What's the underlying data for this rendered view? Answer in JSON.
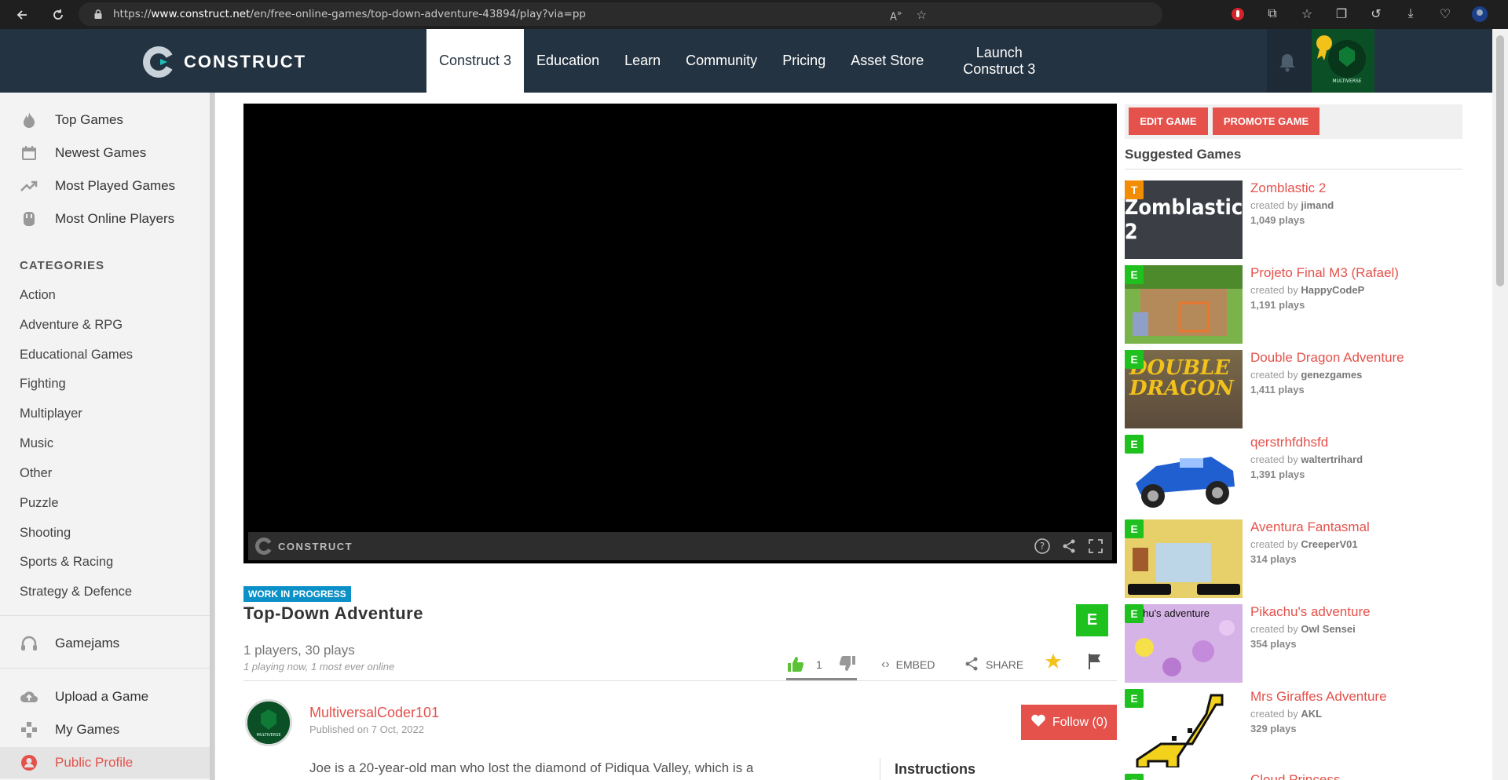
{
  "browser": {
    "url_prefix": "https://",
    "url_host": "www.construct.net",
    "url_path": "/en/free-online-games/top-down-adventure-43894/play?via=pp"
  },
  "header": {
    "logo_text": "CONSTRUCT",
    "nav": [
      "Construct 3",
      "Education",
      "Learn",
      "Community",
      "Pricing",
      "Asset Store"
    ],
    "launch_line1": "Launch",
    "launch_line2": "Construct 3"
  },
  "sidebar": {
    "top_items": [
      "Top Games",
      "Newest Games",
      "Most Played Games",
      "Most Online Players"
    ],
    "categories_heading": "CATEGORIES",
    "categories": [
      "Action",
      "Adventure & RPG",
      "Educational Games",
      "Fighting",
      "Multiplayer",
      "Music",
      "Other",
      "Puzzle",
      "Shooting",
      "Sports & Racing",
      "Strategy & Defence"
    ],
    "gamejams": "Gamejams",
    "bottom_items": [
      "Upload a Game",
      "My Games",
      "Public Profile"
    ]
  },
  "player": {
    "brand": "CONSTRUCT"
  },
  "game": {
    "status_badge": "WORK IN PROGRESS",
    "title": "Top-Down Adventure",
    "rating": "E",
    "plays": "1 players, 30 plays",
    "online": "1 playing now, 1 most ever online",
    "likes": "1",
    "embed_label": "EMBED",
    "share_label": "SHARE",
    "author": "MultiversalCoder101",
    "published": "Published on 7 Oct, 2022",
    "follow_label": "Follow (0)",
    "description": "Joe is a 20-year-old man who lost the diamond of Pidiqua Valley, which is a",
    "instructions_heading": "Instructions"
  },
  "right": {
    "edit_label": "EDIT GAME",
    "promote_label": "PROMOTE GAME",
    "suggested_title": "Suggested Games",
    "created_by": "created by",
    "games": [
      {
        "name": "Zomblastic 2",
        "author": "jimand",
        "plays": "1,049 plays",
        "rating": "T",
        "rating_color": "#f28c00",
        "thumb_text": "Zomblastic 2"
      },
      {
        "name": "Projeto Final M3 (Rafael)",
        "author": "HappyCodeP",
        "plays": "1,191 plays",
        "rating": "E",
        "rating_color": "#1ec11e",
        "thumb_text": ""
      },
      {
        "name": "Double Dragon Adventure",
        "author": "genezgames",
        "plays": "1,411 plays",
        "rating": "E",
        "rating_color": "#1ec11e",
        "thumb_text": "DOUBLE DRAGON"
      },
      {
        "name": "qerstrhfdhsfd",
        "author": "waltertrihard",
        "plays": "1,391 plays",
        "rating": "E",
        "rating_color": "#1ec11e",
        "thumb_text": ""
      },
      {
        "name": "Aventura Fantasmal",
        "author": "CreeperV01",
        "plays": "314 plays",
        "rating": "E",
        "rating_color": "#1ec11e",
        "thumb_text": ""
      },
      {
        "name": "Pikachu's adventure",
        "author": "Owl Sensei",
        "plays": "354 plays",
        "rating": "E",
        "rating_color": "#1ec11e",
        "thumb_text": "ikachu's adventure"
      },
      {
        "name": "Mrs Giraffes Adventure",
        "author": "AKL",
        "plays": "329 plays",
        "rating": "E",
        "rating_color": "#1ec11e",
        "thumb_text": ""
      },
      {
        "name": "Cloud Princess",
        "author": "",
        "plays": "",
        "rating": "E",
        "rating_color": "#1ec11e",
        "thumb_text": ""
      }
    ]
  },
  "colors": {
    "accent": "#e5514b",
    "header_bg": "#243341",
    "rating_e": "#1ec11e",
    "wip": "#0b90c8"
  }
}
